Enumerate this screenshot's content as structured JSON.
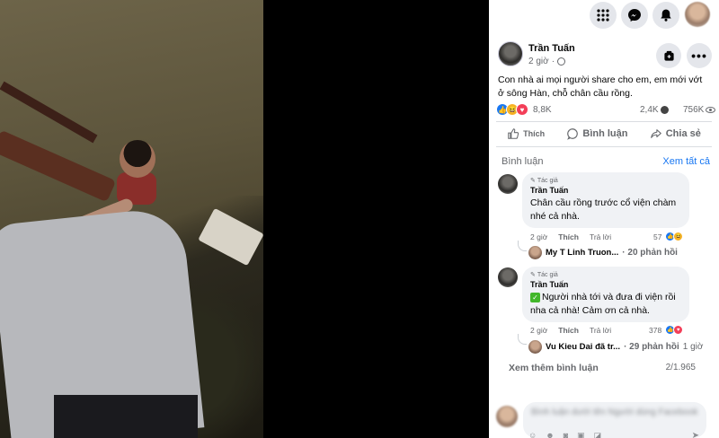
{
  "topbar": {
    "icons": [
      "menu-grid-icon",
      "messenger-icon",
      "bell-icon",
      "profile-avatar"
    ]
  },
  "post": {
    "author": "Trần Tuấn",
    "time": "2 giờ",
    "text": "Con nhà ai mọi người share cho em, em mới vớt ở sông Hàn, chỗ chân cầu rồng.",
    "reaction_count": "8,8K",
    "share_count": "2,4K",
    "view_count": "756K"
  },
  "actions": {
    "like": "Thích",
    "comment": "Bình luận",
    "share": "Chia sẻ"
  },
  "comments_header": {
    "label": "Bình luận",
    "see_all": "Xem tất cả"
  },
  "comments": [
    {
      "tag": "Tác giả",
      "author": "Trần Tuấn",
      "text": "Chân cầu rồng trước cổ viện chàm nhé cả nhà.",
      "time": "2 giờ",
      "like": "Thích",
      "reply": "Trả lời",
      "reactions": "57",
      "reply_name": "My T Linh Truon...",
      "reply_count": "· 20 phản hồi",
      "reply_time": ""
    },
    {
      "tag": "Tác giả",
      "author": "Trần Tuấn",
      "text": "Người nhà tới và đưa đi viện rồi nha cả nhà! Cảm ơn cả nhà.",
      "time": "2 giờ",
      "like": "Thích",
      "reply": "Trả lời",
      "reactions": "378",
      "reply_name": "Vu Kieu Dai đã tr...",
      "reply_count": "· 29 phản hồi",
      "reply_time": "1 giờ"
    }
  ],
  "more_comments": "Xem thêm bình luận",
  "comment_count": "2/1.965",
  "composer": {
    "placeholder": "Bình luận dưới tên Người dùng Facebook"
  },
  "colors": {
    "accent": "#1877f2",
    "like_blue": "#1877f2",
    "love_red": "#f33e58",
    "haha_yellow": "#f7b125"
  }
}
